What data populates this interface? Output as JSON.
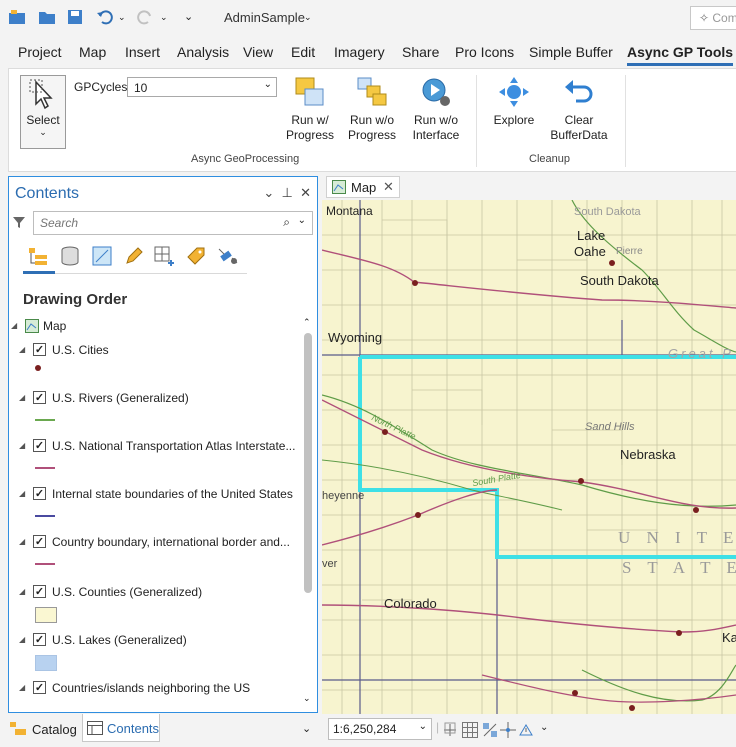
{
  "app": {
    "title": "AdminSample",
    "command_search_placeholder": "Com"
  },
  "menu_tabs": [
    "Project",
    "Map",
    "Insert",
    "Analysis",
    "View",
    "Edit",
    "Imagery",
    "Share",
    "Pro Icons",
    "Simple Buffer",
    "Async GP Tools"
  ],
  "active_tab": "Async GP Tools",
  "ribbon": {
    "select_label": "Select",
    "gpcycles_label": "GPCycles",
    "gpcycles_value": "10",
    "run_progress": [
      "Run w/",
      "Progress"
    ],
    "run_wo_progress": [
      "Run w/o",
      "Progress"
    ],
    "run_wo_interface": [
      "Run w/o",
      "Interface"
    ],
    "group_async": "Async GeoProcessing",
    "explore": "Explore",
    "clear": [
      "Clear",
      "BufferData"
    ],
    "group_cleanup": "Cleanup"
  },
  "contents": {
    "title": "Contents",
    "search_placeholder": "Search",
    "heading": "Drawing Order",
    "map_name": "Map",
    "layers": [
      {
        "name": "U.S. Cities",
        "symbol": "point",
        "color": "#7a1f1f"
      },
      {
        "name": "U.S. Rivers (Generalized)",
        "symbol": "line",
        "color": "#6aa84f"
      },
      {
        "name": "U.S. National Transportation Atlas Interstate...",
        "symbol": "line",
        "color": "#b0507a"
      },
      {
        "name": "Internal state boundaries of the United States",
        "symbol": "line",
        "color": "#4a4aa0"
      },
      {
        "name": "Country boundary, international border and...",
        "symbol": "line",
        "color": "#b0507a"
      },
      {
        "name": "U.S. Counties (Generalized)",
        "symbol": "fill",
        "color": "#faf7d2"
      },
      {
        "name": "U.S. Lakes (Generalized)",
        "symbol": "fill",
        "color": "#b8d2f0"
      },
      {
        "name": "Countries/islands neighboring the US",
        "symbol": "fill",
        "color": "#eeeeee"
      }
    ]
  },
  "bottom_tabs": {
    "catalog": "Catalog",
    "contents": "Contents"
  },
  "map_view": {
    "tab_label": "Map",
    "scale": "1:6,250,284",
    "labels": {
      "montana": "Montana",
      "south_dakota_top": "South Dakota",
      "lake": "Lake",
      "oahe": "Oahe",
      "pierre": "Pierre",
      "south_dakota": "South Dakota",
      "wyoming": "Wyoming",
      "great_plains": "Great P",
      "north_platte": "North Platte",
      "sand_hills": "Sand Hills",
      "nebraska": "Nebraska",
      "cheyenne": "heyenne",
      "south_platte": "South Platte",
      "united": "U N I T E D",
      "states": "S T A T E S",
      "denver": "ver",
      "colorado": "Colorado",
      "kansas": "Ka"
    }
  }
}
